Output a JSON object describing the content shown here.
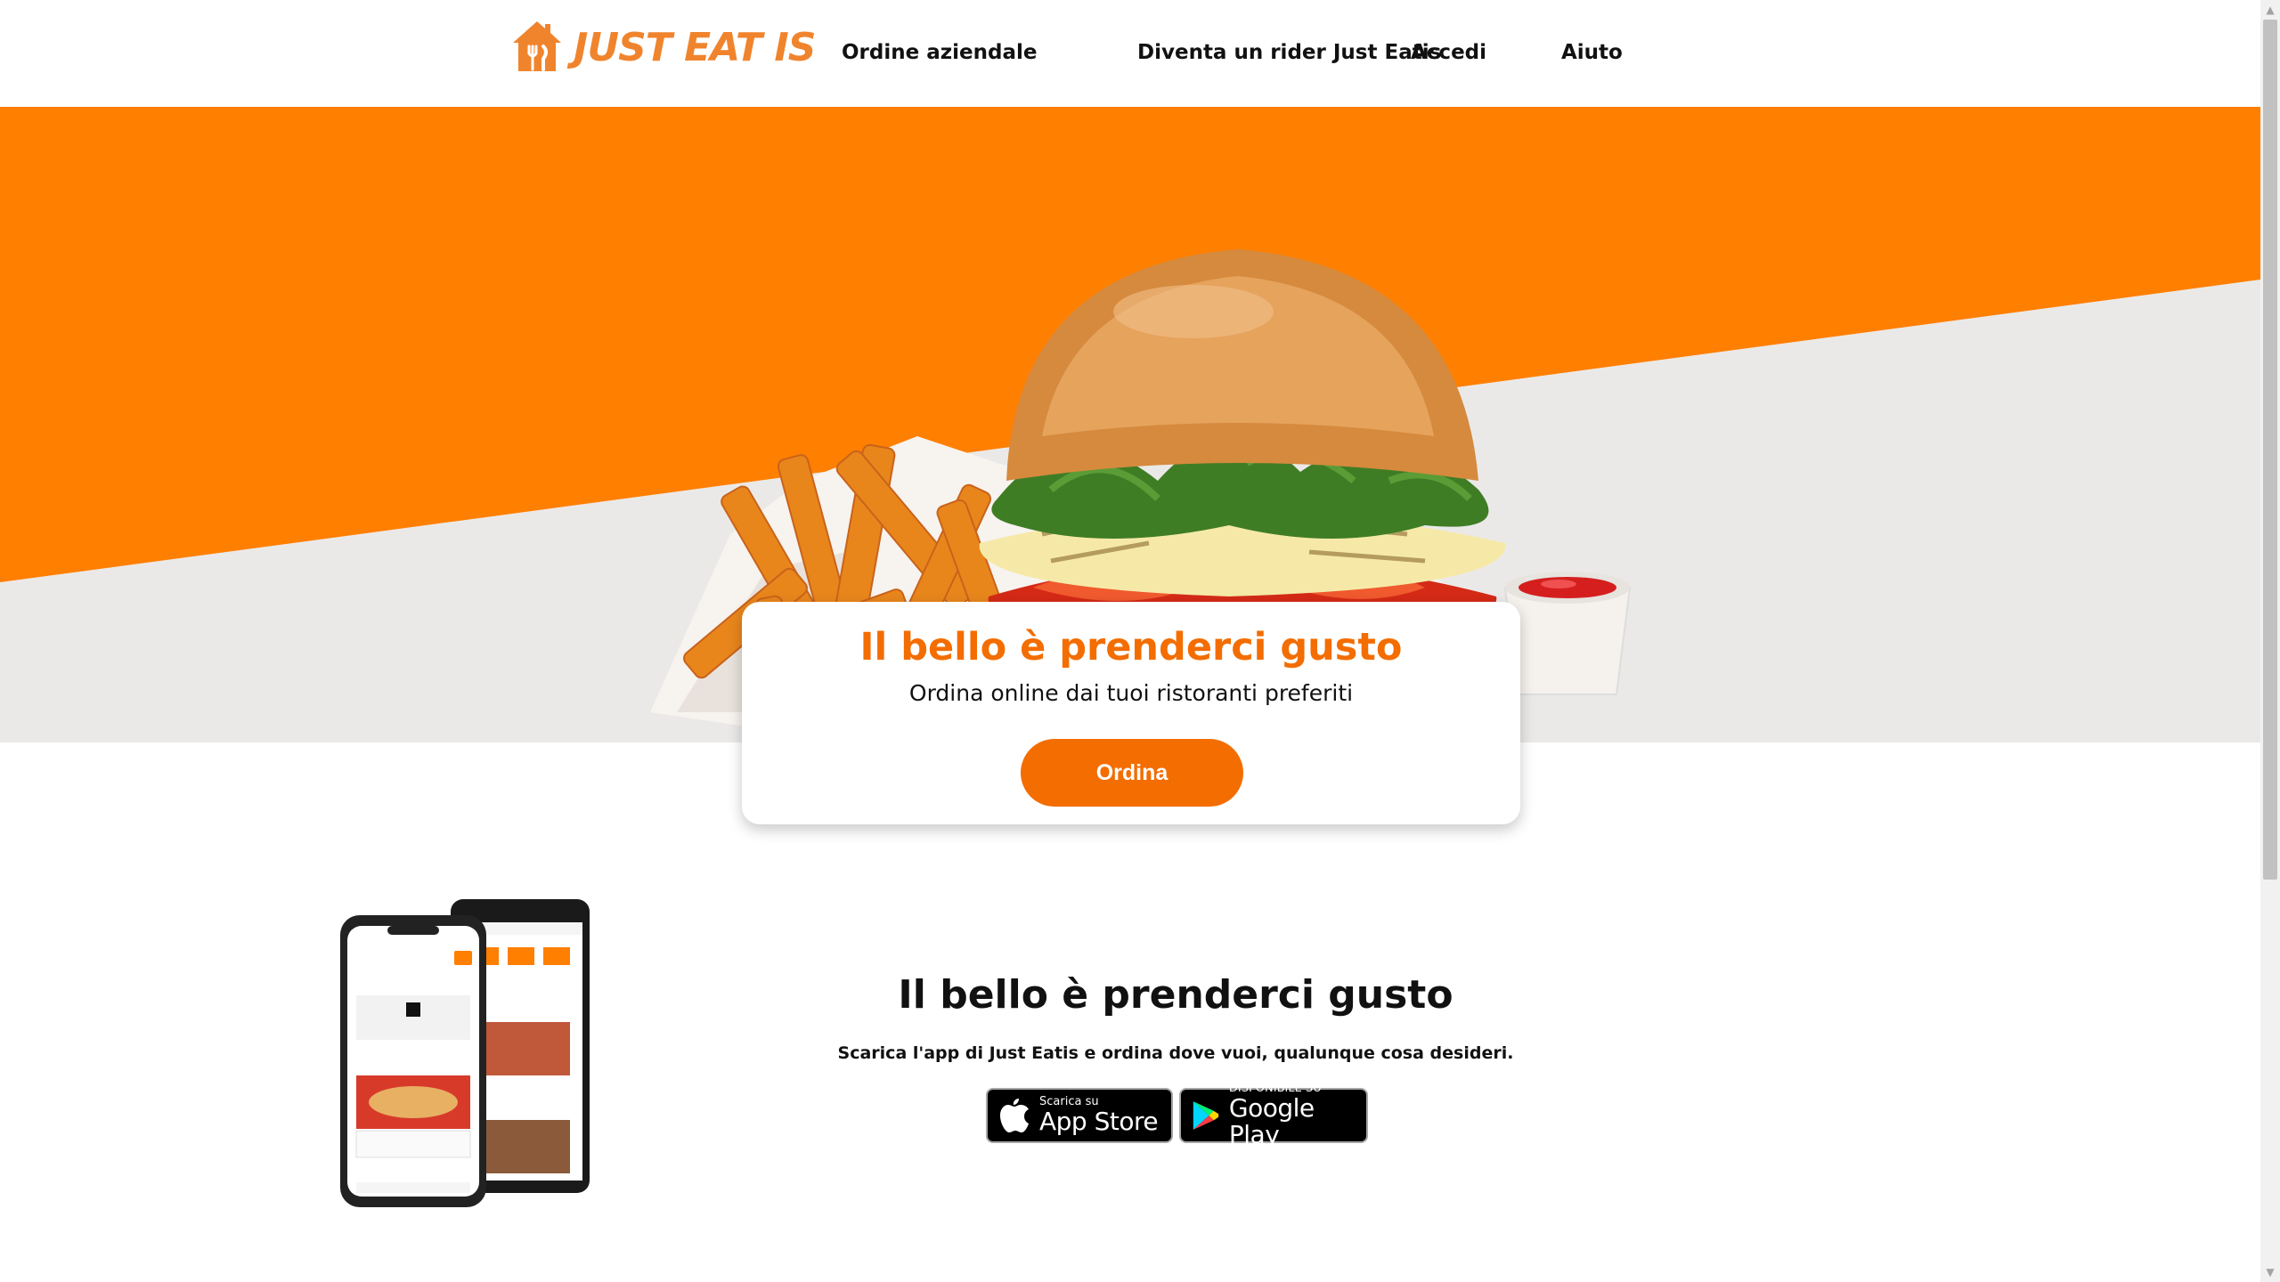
{
  "brand": {
    "name": "JUST EAT IS",
    "accent_color": "#f36d00",
    "logo_color": "#f0842d"
  },
  "nav": {
    "items": [
      {
        "label": "Ordine aziendale"
      },
      {
        "label": "Diventa un rider Just Eatis"
      },
      {
        "label": "Accedi"
      },
      {
        "label": "Aiuto"
      }
    ]
  },
  "hero": {
    "image": "burger-with-fries-and-ketchup",
    "title": "Il bello è prenderci gusto",
    "subtitle": "Ordina online dai tuoi ristoranti preferiti",
    "cta_label": "Ordina"
  },
  "app_section": {
    "image": "phones-app-preview",
    "title": "Il bello è prenderci gusto",
    "subtitle": "Scarica l'app di Just Eatis e ordina dove vuoi, qualunque cosa desideri.",
    "app_store": {
      "small": "Scarica su",
      "big": "App Store",
      "icon": "apple-icon"
    },
    "google_play": {
      "small": "DISPONIBILE SU",
      "big": "Google Play",
      "icon": "google-play-icon"
    }
  }
}
